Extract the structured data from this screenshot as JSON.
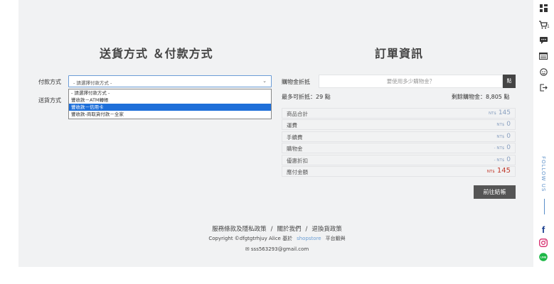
{
  "checkout": {
    "left_title": "送貨方式 ＆付款方式",
    "right_title": "訂單資訊",
    "payment_label": "付款方式",
    "shipping_label": "送貨方式",
    "payment_select_value": "- 請選擇付款方式 -",
    "payment_options": [
      "- 請選擇付款方式 -",
      "豐收款－ATM轉帳",
      "豐收款－信用卡",
      "豐收款-商取貨付款－全家"
    ],
    "selected_option_index": 2,
    "points_label": "購物金折抵",
    "points_placeholder": "要使用多少購物金？",
    "points_button": "點",
    "max_deduct": "最多可折抵：29 點",
    "remaining_points": "剩餘購物金：8,805 點",
    "summary": [
      {
        "label": "商品合計",
        "prefix": "NT$",
        "value": "145",
        "highlight": false
      },
      {
        "label": "運費",
        "prefix": "NT$",
        "value": "0",
        "highlight": false
      },
      {
        "label": "手續費",
        "prefix": "NT$",
        "value": "0",
        "highlight": false
      },
      {
        "label": "購物金",
        "prefix": "- NT$",
        "value": "0",
        "highlight": false
      },
      {
        "label": "優惠折扣",
        "prefix": "- NT$",
        "value": "0",
        "highlight": false
      },
      {
        "label": "應付金額",
        "prefix": "NT$",
        "value": "145",
        "highlight": true
      }
    ],
    "checkout_button": "前往結帳"
  },
  "footer": {
    "links": [
      "服務條款及隱私政策",
      "關於我們",
      "退換貨政策"
    ],
    "copyright": "Copyright ©dfgtgtrhjuy Alice 基於",
    "brand": "shopstore",
    "platform": "平台鍛與",
    "email": "sss563293@gmail.com"
  },
  "sidebar": {
    "cart_count": "1",
    "follow_text": "FOLLOW US",
    "colors": {
      "facebook": "#1b3f8f",
      "instagram": "#d6286b",
      "line": "#1db847"
    }
  }
}
